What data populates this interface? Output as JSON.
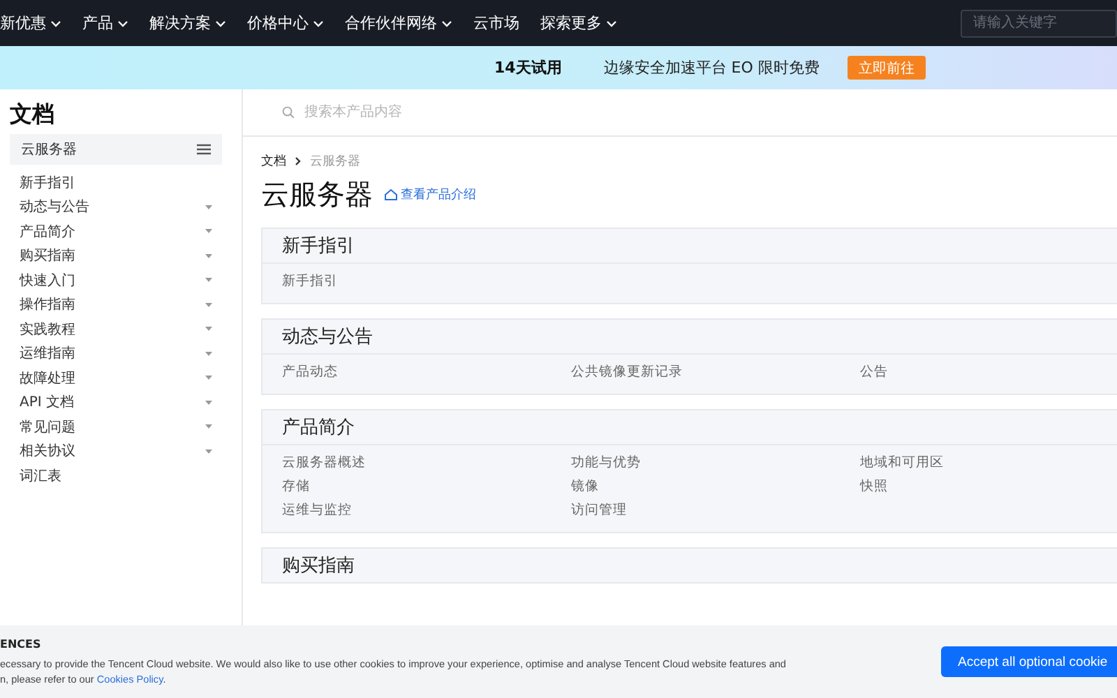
{
  "nav": {
    "items": [
      {
        "label": "新优惠",
        "dropdown": true
      },
      {
        "label": "产品",
        "dropdown": true
      },
      {
        "label": "解决方案",
        "dropdown": true
      },
      {
        "label": "价格中心",
        "dropdown": true
      },
      {
        "label": "合作伙伴网络",
        "dropdown": true
      },
      {
        "label": "云市场",
        "dropdown": false
      },
      {
        "label": "探索更多",
        "dropdown": true
      }
    ],
    "search": {
      "placeholder": "请输入关键字"
    }
  },
  "banner": {
    "badge": "14天试用",
    "text": "边缘安全加速平台 EO 限时免费",
    "button": "立即前往"
  },
  "sidebar": {
    "title": "文档",
    "product": "云服务器",
    "items": [
      {
        "label": "新手指引",
        "expandable": false
      },
      {
        "label": "动态与公告",
        "expandable": true
      },
      {
        "label": "产品简介",
        "expandable": true
      },
      {
        "label": "购买指南",
        "expandable": true
      },
      {
        "label": "快速入门",
        "expandable": true
      },
      {
        "label": "操作指南",
        "expandable": true
      },
      {
        "label": "实践教程",
        "expandable": true
      },
      {
        "label": "运维指南",
        "expandable": true
      },
      {
        "label": "故障处理",
        "expandable": true
      },
      {
        "label": "API 文档",
        "expandable": true
      },
      {
        "label": "常见问题",
        "expandable": true
      },
      {
        "label": "相关协议",
        "expandable": true
      },
      {
        "label": "词汇表",
        "expandable": false
      }
    ]
  },
  "content": {
    "search": {
      "placeholder": "搜索本产品内容"
    },
    "breadcrumb": [
      "文档",
      "云服务器"
    ],
    "title": "云服务器",
    "intro_link": "查看产品介绍",
    "sections": [
      {
        "title": "新手指引",
        "links": [
          "新手指引"
        ]
      },
      {
        "title": "动态与公告",
        "links": [
          "产品动态",
          "公共镜像更新记录",
          "公告"
        ]
      },
      {
        "title": "产品简介",
        "links": [
          "云服务器概述",
          "功能与优势",
          "地域和可用区",
          "存储",
          "镜像",
          "快照",
          "运维与监控",
          "访问管理"
        ]
      },
      {
        "title": "购买指南"
      }
    ]
  },
  "cookie_bar": {
    "title": "ENCES",
    "line1": "ecessary to provide the Tencent Cloud website. We would also like to use other cookies to improve your experience, optimise and analyse Tencent Cloud website features and",
    "line2_before": "n, please refer to our ",
    "link": "Cookies Policy",
    "line2_after": ".",
    "button": "Accept all optional cookie"
  }
}
